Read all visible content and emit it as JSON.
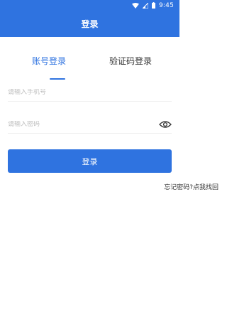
{
  "status_bar": {
    "time": "9:45"
  },
  "header": {
    "title": "登录"
  },
  "tabs": [
    {
      "label": "账号登录",
      "active": true
    },
    {
      "label": "验证码登录",
      "active": false
    }
  ],
  "form": {
    "phone_placeholder": "请输入手机号",
    "password_placeholder": "请输入密码",
    "submit_label": "登录",
    "forgot_label": "忘记密码?点我找回"
  },
  "colors": {
    "primary": "#2f73e0",
    "background": "#ffffff",
    "divider": "#efefef"
  },
  "icons": [
    "wifi-icon",
    "cellular-signal-icon",
    "battery-icon",
    "eye-icon"
  ]
}
